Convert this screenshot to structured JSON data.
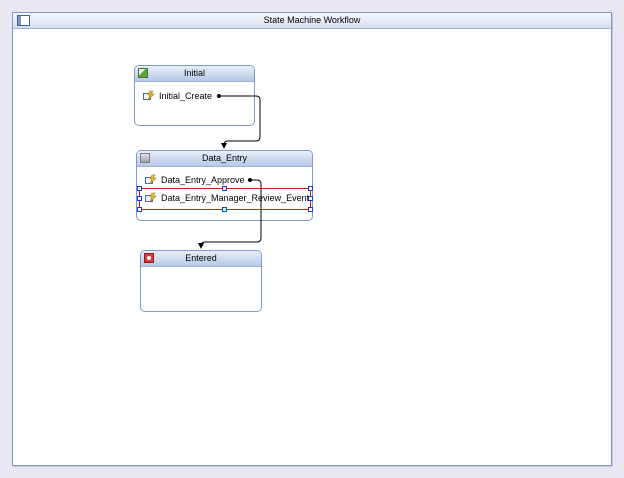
{
  "designer": {
    "title": "State Machine Workflow"
  },
  "states": {
    "initial": {
      "title": "Initial",
      "icon": "initial-state-icon",
      "events": [
        "Initial_Create"
      ]
    },
    "data_entry": {
      "title": "Data_Entry",
      "icon": "state-icon",
      "events": [
        "Data_Entry_Approve",
        "Data_Entry_Manager_Review_Event"
      ]
    },
    "entered": {
      "title": "Entered",
      "icon": "completed-state-icon",
      "events": []
    }
  },
  "selected_event": "Data_Entry_Manager_Review_Event",
  "colors": {
    "selection_border": "#e2121b",
    "handle_border": "#1c3bd6",
    "state_border": "#7f9ac9"
  }
}
